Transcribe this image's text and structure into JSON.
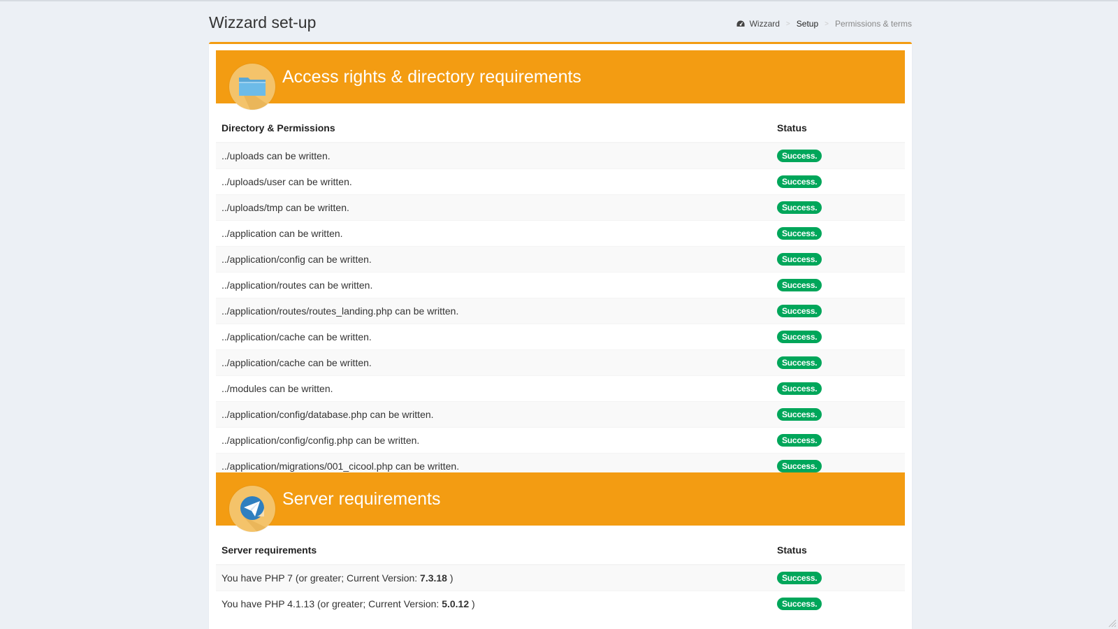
{
  "header": {
    "title": "Wizzard set-up",
    "breadcrumb": [
      {
        "label": "Wizzard",
        "icon": "dashboard-icon"
      },
      {
        "label": "Setup"
      },
      {
        "label": "Permissions & terms"
      }
    ],
    "separator": ">"
  },
  "colors": {
    "banner": "#f39c12",
    "success": "#00a65a",
    "page_bg": "#ecf0f5"
  },
  "access_section": {
    "title": "Access rights & directory requirements",
    "icon": "folder-icon",
    "columns": {
      "item": "Directory & Permissions",
      "status": "Status"
    },
    "rows": [
      {
        "text": "../uploads can be written.",
        "status": "Success."
      },
      {
        "text": "../uploads/user can be written.",
        "status": "Success."
      },
      {
        "text": "../uploads/tmp can be written.",
        "status": "Success."
      },
      {
        "text": "../application can be written.",
        "status": "Success."
      },
      {
        "text": "../application/config can be written.",
        "status": "Success."
      },
      {
        "text": "../application/routes can be written.",
        "status": "Success."
      },
      {
        "text": "../application/routes/routes_landing.php can be written.",
        "status": "Success."
      },
      {
        "text": "../application/cache can be written.",
        "status": "Success."
      },
      {
        "text": "../application/cache can be written.",
        "status": "Success."
      },
      {
        "text": "../modules can be written.",
        "status": "Success."
      },
      {
        "text": "../application/config/database.php can be written.",
        "status": "Success."
      },
      {
        "text": "../application/config/config.php can be written.",
        "status": "Success."
      },
      {
        "text": "../application/migrations/001_cicool.php can be written.",
        "status": "Success."
      }
    ]
  },
  "server_section": {
    "title": "Server requirements",
    "icon": "paper-plane-icon",
    "columns": {
      "item": "Server requirements",
      "status": "Status"
    },
    "rows": [
      {
        "prefix": "You have PHP 7 (or greater; Current Version: ",
        "version": "7.3.18",
        "suffix": " )",
        "status": "Success."
      },
      {
        "prefix": "You have PHP 4.1.13 (or greater; Current Version: ",
        "version": "5.0.12",
        "suffix": " )",
        "status": "Success."
      }
    ]
  }
}
